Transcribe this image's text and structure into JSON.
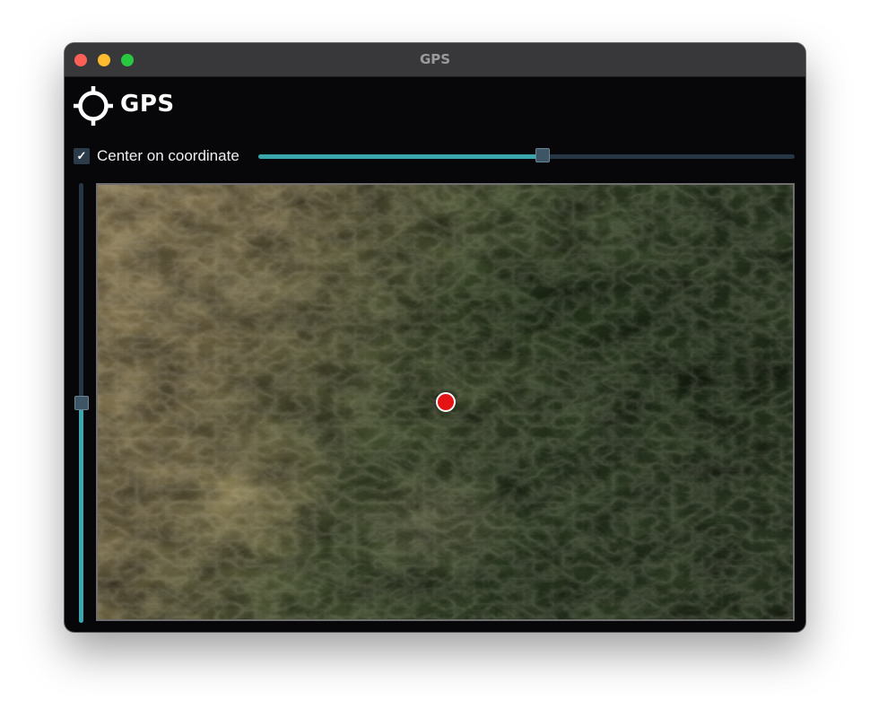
{
  "window": {
    "title": "GPS"
  },
  "header": {
    "icon": "crosshair-icon",
    "title": "GPS"
  },
  "controls": {
    "center_checkbox": {
      "checked": true,
      "check_glyph": "✓",
      "label": "Center on coordinate"
    },
    "horizontal_slider": {
      "value_fraction": 0.53
    },
    "vertical_slider": {
      "value_fraction": 0.5
    }
  },
  "map": {
    "type": "satellite terrain",
    "marker": {
      "icon": "location-marker",
      "color": "#e51414",
      "position_fraction": [
        0.5,
        0.5
      ]
    }
  },
  "colors": {
    "accent": "#3aa6ad",
    "track": "#273644",
    "handle": "#3e5566",
    "background": "#07070a"
  }
}
